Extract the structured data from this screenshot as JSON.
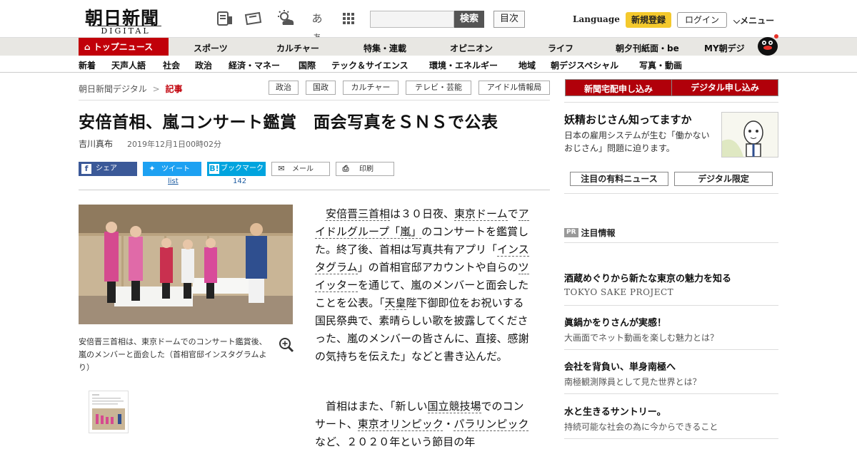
{
  "header": {
    "logo_kanji": "朝日新聞",
    "logo_sub": "DIGITAL",
    "search_button": "検索",
    "toc_button": "目次",
    "language": "Language",
    "signup": "新規登録",
    "login": "ログイン",
    "menu": "メニュー",
    "aa_icon": "あぁ"
  },
  "nav": {
    "items": [
      "トップニュース",
      "スポーツ",
      "カルチャー",
      "特集・連載",
      "オピニオン",
      "ライフ",
      "朝夕刊紙面・be",
      "MY朝デジ"
    ]
  },
  "subnav": {
    "items": [
      "新着",
      "天声人語",
      "社会",
      "政治",
      "経済・マネー",
      "国際",
      "テック＆サイエンス",
      "環境・エネルギー",
      "地域",
      "朝デジスペシャル",
      "写真・動画"
    ]
  },
  "breadcrumb": {
    "home": "朝日新聞デジタル",
    "sep": ">",
    "current": "記事"
  },
  "tags": [
    "政治",
    "国政",
    "カルチャー",
    "テレビ・芸能",
    "アイドル情報局"
  ],
  "article": {
    "title": "安倍首相、嵐コンサート鑑賞　面会写真をＳＮＳで公表",
    "author": "吉川真布",
    "date": "2019年12月1日00時02分",
    "share": {
      "facebook": "シェア",
      "twitter": "ツイート",
      "hatena": "ブックマーク",
      "mail": "メール",
      "print": "印刷",
      "twitter_count": "list",
      "hatena_count": "142"
    },
    "caption": "安倍晋三首相は、東京ドームでのコンサート鑑賞後、嵐のメンバーと面会した（首相官邸インスタグラムより）",
    "p1": {
      "a": "安倍晋三首相",
      "b": "は３０日夜、",
      "c": "東京ドーム",
      "d": "で",
      "e": "アイドルグループ「嵐」",
      "f": "のコンサートを鑑賞した。終了後、首相は写真共有アプリ「",
      "g": "インスタグラム",
      "h": "」の首相官邸アカウントや自らの",
      "i": "ツイッター",
      "j": "を通じて、嵐のメンバーと面会したことを公表。「",
      "k": "天皇",
      "l": "陛下御即位をお祝いする国民祭典で、素晴らしい歌を披露してくださった、嵐のメンバーの皆さんに、直接、感謝の気持ちを伝えた」などと書き込んだ。"
    },
    "p2": {
      "a": "首相はまた、「新しい",
      "b": "国立競技場",
      "c": "でのコンサート、",
      "d": "東京オリンピック",
      "e": "・",
      "f": "パラリンピック",
      "g": "など、２０２０年という節目の年"
    }
  },
  "sidebar": {
    "btn_newspaper": "新聞宅配申し込み",
    "btn_digital": "デジタル申し込み",
    "promo_title": "妖精おじさん知ってますか",
    "promo_text": "日本の雇用システムが生む「働かないおじさん」問題に迫ります。",
    "btn_paid": "注目の有料ニュース",
    "btn_limited": "デジタル限定",
    "pr_badge": "PR",
    "pr_title": "注目情報",
    "ads": [
      {
        "title": "酒蔵めぐりから新たな東京の魅力を知る",
        "sub": "TOKYO SAKE PROJECT"
      },
      {
        "title": "眞鍋かをりさんが実感！",
        "sub": "大画面でネット動画を楽しむ魅力とは？"
      },
      {
        "title": "会社を背負い、単身南極へ",
        "sub": "南極観測隊員として見た世界とは？"
      },
      {
        "title": "水と生きるサントリー。",
        "sub": "持続可能な社会の為に今からできること"
      }
    ]
  },
  "colors": {
    "brand_red": "#c1000a",
    "signup_yellow": "#f4c92d",
    "twitter": "#1da1f2",
    "facebook": "#3b5998",
    "hatena": "#00a4de"
  }
}
